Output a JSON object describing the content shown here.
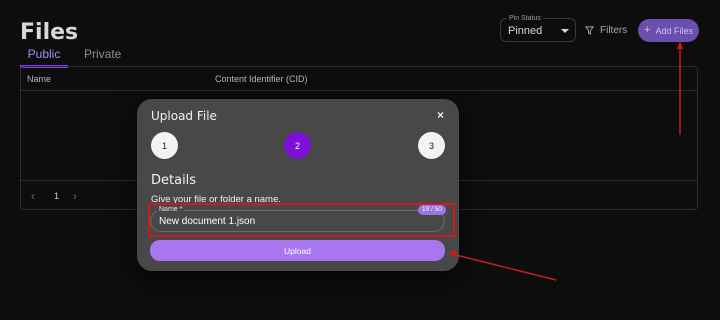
{
  "page": {
    "title": "Files",
    "tabs": [
      {
        "label": "Public",
        "active": true
      },
      {
        "label": "Private",
        "active": false
      }
    ]
  },
  "toolbar": {
    "pin_status_label": "Pin Status",
    "pin_status_value": "Pinned",
    "filters_label": "Filters",
    "add_files_label": "Add Files"
  },
  "table": {
    "columns": [
      "Name",
      "Content Identifier (CID)"
    ],
    "page_number": "1"
  },
  "modal": {
    "title": "Upload File",
    "close_glyph": "×",
    "steps": [
      "1",
      "2",
      "3"
    ],
    "active_step": 2,
    "details_heading": "Details",
    "details_subtitle": "Give your file or folder a name.",
    "name_label": "Name *",
    "name_value": "New document 1.json",
    "char_counter": "19 / 50",
    "upload_label": "Upload"
  },
  "icons": {
    "filter": "filter-funnel-icon",
    "add": "plus-icon",
    "caret": "chevron-down-icon",
    "prev": "chevron-left-icon",
    "next": "chevron-right-icon"
  },
  "colors": {
    "accent": "#7c3aed",
    "step_active": "#7c10d8",
    "upload_button": "#a877f0",
    "annotation": "#c91d1d"
  }
}
